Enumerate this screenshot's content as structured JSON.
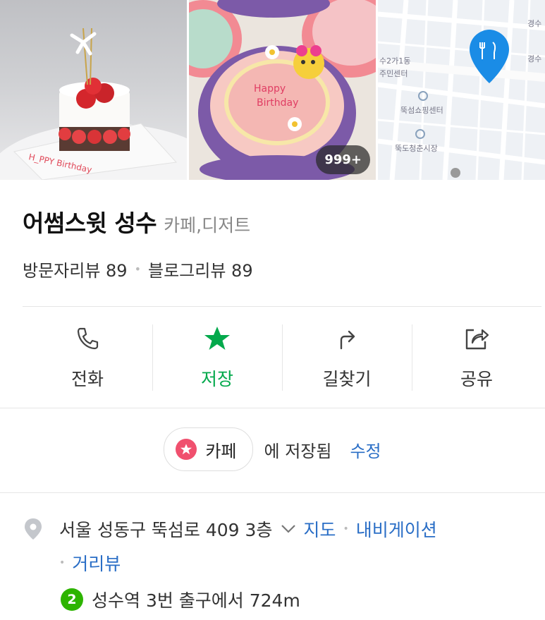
{
  "gallery": {
    "photo_count_badge": "999+",
    "map": {
      "labels": [
        "경수",
        "수2가1동",
        "주민센터",
        "뚝섬쇼핑센터",
        "뚝도청춘시장",
        "경수"
      ],
      "pin_color": "#1a8ce6"
    }
  },
  "place": {
    "name": "어썸스윗 성수",
    "category": "카페,디저트",
    "visitor_reviews": "방문자리뷰 89",
    "blog_reviews": "블로그리뷰 89"
  },
  "actions": [
    {
      "label": "전화",
      "icon": "phone-icon"
    },
    {
      "label": "저장",
      "icon": "star-icon",
      "active": true
    },
    {
      "label": "길찾기",
      "icon": "directions-icon"
    },
    {
      "label": "공유",
      "icon": "share-icon"
    }
  ],
  "saved": {
    "folder_name": "카페",
    "saved_text": "에 저장됨",
    "edit_label": "수정"
  },
  "address": {
    "text": "서울 성동구 뚝섬로 409 3층",
    "map_link": "지도",
    "navigation_link": "내비게이션",
    "street_view_link": "거리뷰"
  },
  "subway": {
    "line_number": "2",
    "line_color": "#2db400",
    "text": "성수역 3번 출구에서 724m"
  },
  "colors": {
    "accent_green": "#03a94c",
    "link_blue": "#2a6ec6",
    "chip_star": "#f0506e"
  }
}
